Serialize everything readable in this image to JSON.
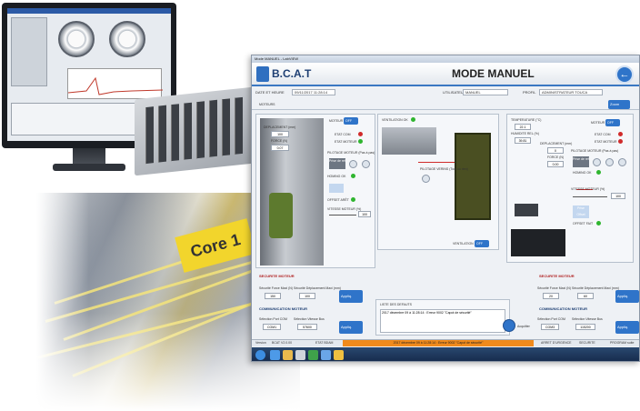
{
  "window": {
    "title": "Mode MANUEL - LabVIEW"
  },
  "header": {
    "app_name": "B.C.A.T",
    "mode_title": "MODE MANUEL",
    "home_icon": "home-arrow-icon"
  },
  "infobar": {
    "date_label": "DATE ET HEURE",
    "date_value": "09/11/2017 11:28:14",
    "user_label": "UTILISATEUR",
    "user_value": "MANUEL",
    "profile_label": "PROFIL",
    "profile_value": "ADMINISTRATEUR TOUCA"
  },
  "motor_bar": {
    "label": "MOTEURS",
    "zoom_label": "Zoom"
  },
  "left_pane": {
    "displacement_label": "DEPLACEMENT (mm)",
    "displacement_value": "100",
    "force_label": "FORCE (N)",
    "force_value": "0.07",
    "motor_label": "MOTEUR",
    "motor_toggle": "OFF",
    "state_com": "ETAT COM",
    "state_motor": "ETAT MOTEUR",
    "pilotage_label": "PILOTAGE MOTEUR (Pas à pas)",
    "prise_label": "Prise de ref",
    "homing_label": "HOMING OK",
    "offset_label": "OFFSET ARÊT",
    "speed_label": "VITESSE MOTEUR (%)",
    "speed_value": "100",
    "speed_ticks": [
      "0",
      "25",
      "50",
      "75",
      "100"
    ]
  },
  "middle_pane": {
    "ventilation_label": "VENTILATION OK",
    "pilotage_label": "PILOTAGE VERINS (Tout ou rien)",
    "ventilation_toggle_label": "VENTILATION",
    "ventilation_toggle": "OFF"
  },
  "right_pane": {
    "temperature_label": "TEMPERATURE (°C)",
    "temperature_value": "22.1",
    "humidity_label": "HUMIDITE REL (%)",
    "humidity_value": "39.81",
    "displacement_label": "DEPLACEMENT (mm)",
    "displacement_value": "0",
    "force_label": "FORCE (N)",
    "force_value": "0.00",
    "motor_label": "MOTEUR",
    "motor_toggle": "OFF",
    "state_com": "ETAT COM",
    "state_motor": "ETAT MOTEUR",
    "pilotage_label": "PILOTAGE MOTEUR (Pas à pas)",
    "prise_label": "Prise de ref",
    "homing_label": "HOMING OK",
    "speed_label": "VITESSE MOTEUR (%)",
    "speed_value": "100",
    "speed_ticks": [
      "0",
      "25",
      "50",
      "75",
      "100"
    ],
    "prise_off": "Prise Offset",
    "offset_label": "OFFSET FAIT"
  },
  "left_settings": {
    "title": "SECURITE MOTEUR",
    "max_force_label": "Sécurité Force Maxi (N)",
    "max_force_value": "150",
    "max_disp_label": "Sécurité Déplacement Maxi (mm)",
    "max_disp_value": "100",
    "apply_label": "Appliq.",
    "com_title": "COMMUNICATION MOTEUR",
    "port_label": "Sélection Port COM",
    "port_value": "COM1",
    "speed_label": "Sélection Vitesse Bus",
    "speed_value": "57600",
    "apply_label2": "Appliq."
  },
  "right_settings": {
    "title": "SECURITE MOTEUR",
    "max_force_label": "Sécurité Force Maxi (N)",
    "max_force_value": "20",
    "max_disp_label": "Sécurité Déplacement Maxi (mm)",
    "max_disp_value": "60",
    "apply_label": "Appliq.",
    "com_title": "COMMUNICATION MOTEUR",
    "port_label": "Sélection Port COM",
    "port_value": "COM3",
    "speed_label": "Sélection Vitesse Bus",
    "speed_value": "115200",
    "apply_label2": "Appliq."
  },
  "faults": {
    "title": "LISTE DES DEFAUTS",
    "entry": "2017 décembre 09 à 11:28:14 : Erreur 9002 \"Capot de sécurité\"",
    "ack_label": "Acquitter"
  },
  "status_bar": {
    "version_label": "Version",
    "version_value": "BCAT V2.0.00",
    "state_label": "ETAT BDAM",
    "alarm_text": "2017 décembre 09 à 11:28:14 : Erreur 9002 \"Capot de sécurité\"",
    "emergency_label": "ARRET D'URGENCE",
    "safety_label": "SECURITE",
    "prog_label": "PROGRAM suite"
  },
  "overlay": {
    "core_label": "Core 1"
  },
  "colors": {
    "accent": "#2f74c9",
    "alarm": "#f08a1c",
    "led_green": "#2fb52f",
    "led_red": "#d02b2b"
  }
}
